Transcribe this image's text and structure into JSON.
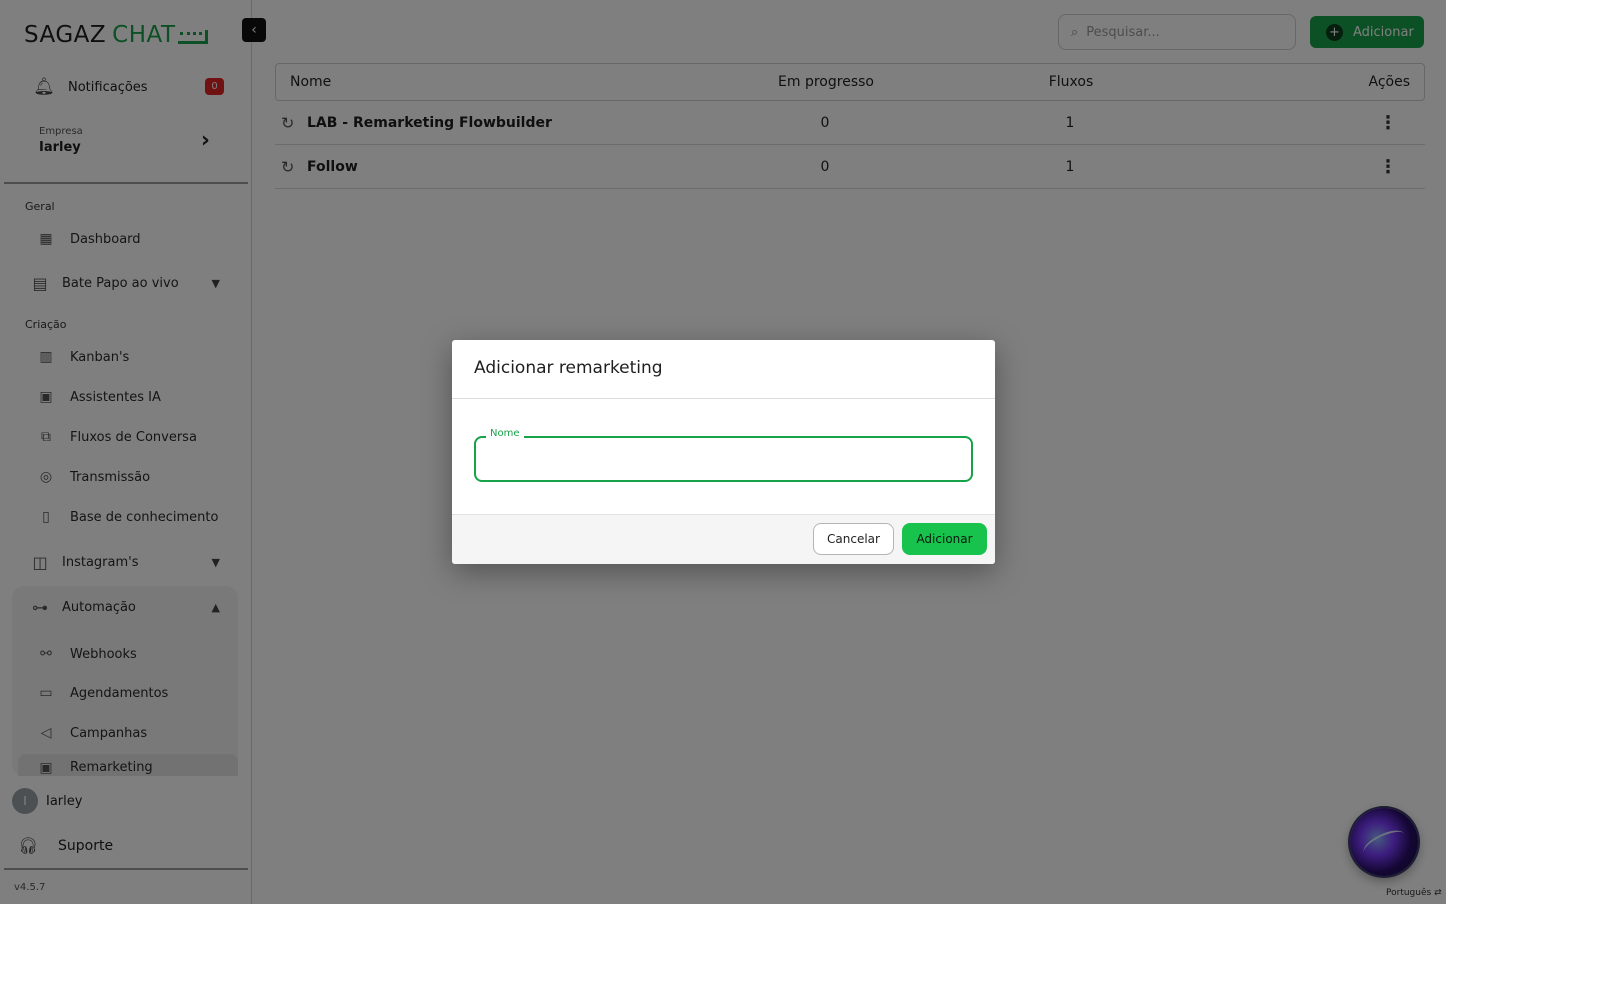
{
  "sidebar": {
    "logo_part1": "SAGAZ",
    "logo_part2": "CHAT",
    "notifications_label": "Notificações",
    "notifications_count": "0",
    "company_caption": "Empresa",
    "company_name": "Iarley",
    "section_geral": "Geral",
    "section_criacao": "Criação",
    "items": {
      "dashboard": "Dashboard",
      "live_chat": "Bate Papo ao vivo",
      "kanbans": "Kanban's",
      "ai_assistants": "Assistentes IA",
      "flows": "Fluxos de Conversa",
      "broadcast": "Transmissão",
      "knowledge": "Base de conhecimento",
      "instagram": "Instagram's",
      "automation": "Automação",
      "webhooks": "Webhooks",
      "schedules": "Agendamentos",
      "campaigns": "Campanhas",
      "remarketing": "Remarketing"
    },
    "user_initial": "I",
    "user_name": "Iarley",
    "support_label": "Suporte",
    "version": "v4.5.7"
  },
  "toolbar": {
    "search_placeholder": "Pesquisar...",
    "add_label": "Adicionar"
  },
  "table": {
    "headers": {
      "name": "Nome",
      "progress": "Em progresso",
      "flows": "Fluxos",
      "actions": "Ações"
    },
    "rows": [
      {
        "name": "LAB - Remarketing Flowbuilder",
        "progress": "0",
        "flows": "1"
      },
      {
        "name": "Follow",
        "progress": "0",
        "flows": "1"
      }
    ]
  },
  "language": "Português",
  "modal": {
    "title": "Adicionar remarketing",
    "field_label": "Nome",
    "field_value": "",
    "cancel_label": "Cancelar",
    "submit_label": "Adicionar"
  },
  "colors": {
    "brand_green": "#17a34a",
    "badge_red": "#e02424"
  }
}
